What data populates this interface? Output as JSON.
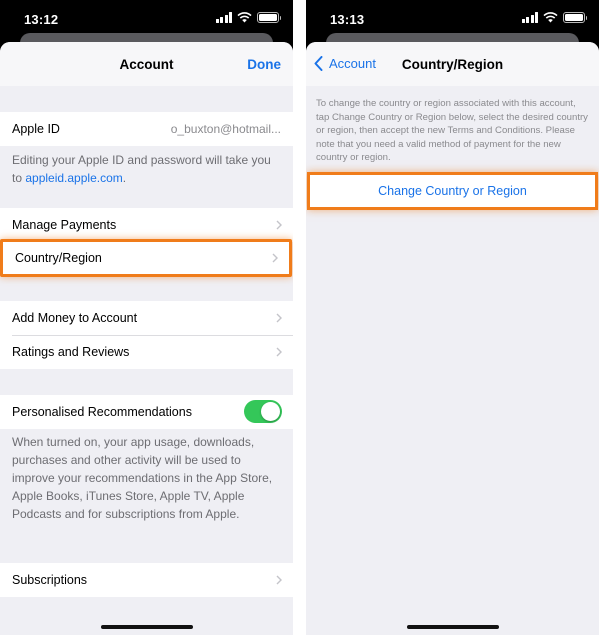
{
  "left": {
    "status": {
      "time": "13:12"
    },
    "nav": {
      "title": "Account",
      "done": "Done"
    },
    "apple_id": {
      "label": "Apple ID",
      "value": "o_buxton@hotmail..."
    },
    "apple_id_note": {
      "text": "Editing your Apple ID and password will take you to ",
      "link": "appleid.apple.com",
      "suffix": "."
    },
    "payments": {
      "manage_payments": "Manage Payments",
      "country_region": "Country/Region"
    },
    "money": {
      "add_money": "Add Money to Account",
      "ratings": "Ratings and Reviews"
    },
    "recommendations": {
      "label": "Personalised Recommendations",
      "enabled": true,
      "note": "When turned on, your app usage, downloads, purchases and other activity will be used to improve your recommendations in the App Store, Apple Books, iTunes Store, Apple TV, Apple Podcasts and for subscriptions from Apple."
    },
    "subscriptions": {
      "label": "Subscriptions"
    }
  },
  "right": {
    "status": {
      "time": "13:13"
    },
    "nav": {
      "back": "Account",
      "title": "Country/Region"
    },
    "description": "To change the country or region associated with this account, tap Change Country or Region below, select the desired country or region, then accept the new Terms and Conditions. Please note that you need a valid method of payment for the new country or region.",
    "button": "Change Country or Region"
  },
  "colors": {
    "accent": "#1a73e8",
    "highlight": "#f07c1a",
    "toggle_on": "#34c759",
    "background": "#efeff4"
  }
}
